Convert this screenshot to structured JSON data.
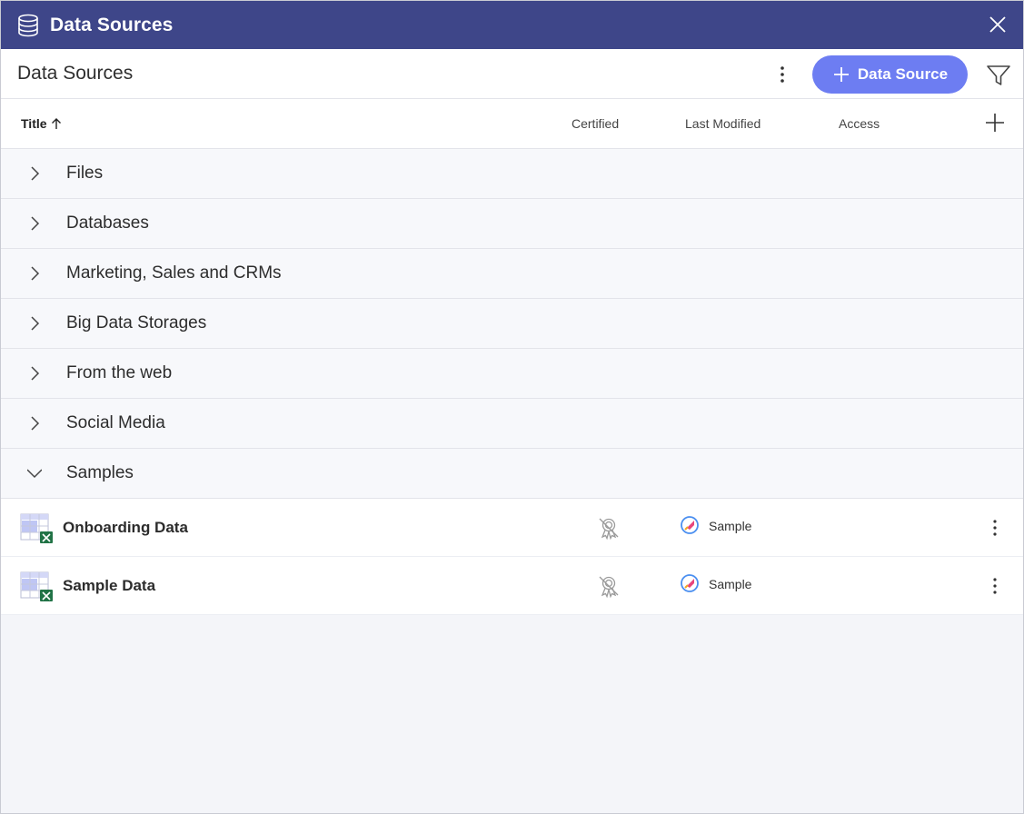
{
  "window": {
    "title": "Data Sources",
    "db_icon": "database-icon",
    "close_icon": "close-icon"
  },
  "toolbar": {
    "heading": "Data Sources",
    "more_icon": "more-vertical-icon",
    "add_button_label": "Data Source",
    "add_button_icon": "plus-icon",
    "filter_icon": "filter-icon"
  },
  "columns": {
    "title": "Title",
    "certified": "Certified",
    "last_modified": "Last Modified",
    "access": "Access",
    "sort_icon": "arrow-up-icon",
    "add_column_icon": "plus-icon"
  },
  "groups": [
    {
      "label": "Files",
      "expanded": false
    },
    {
      "label": "Databases",
      "expanded": false
    },
    {
      "label": "Marketing, Sales and CRMs",
      "expanded": false
    },
    {
      "label": "Big Data Storages",
      "expanded": false
    },
    {
      "label": "From the web",
      "expanded": false
    },
    {
      "label": "Social Media",
      "expanded": false
    },
    {
      "label": "Samples",
      "expanded": true
    }
  ],
  "samples": [
    {
      "title": "Onboarding Data",
      "certified_icon": "not-certified-icon",
      "access": "Sample",
      "access_icon": "rocket-icon"
    },
    {
      "title": "Sample Data",
      "certified_icon": "not-certified-icon",
      "access": "Sample",
      "access_icon": "rocket-icon"
    }
  ],
  "colors": {
    "titlebar": "#3e4689",
    "accent": "#6d7df2",
    "background": "#f4f5f9"
  }
}
